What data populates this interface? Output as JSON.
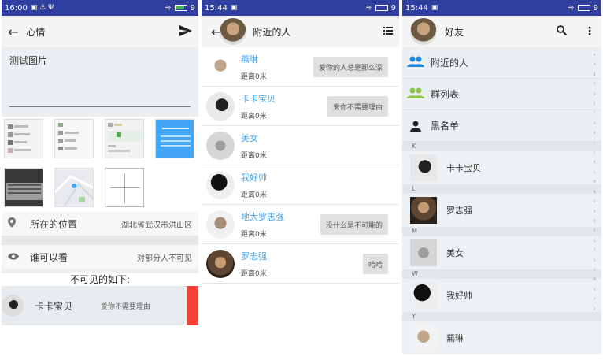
{
  "panel1": {
    "status": {
      "time": "16:00",
      "battery": "9"
    },
    "title": "心情",
    "mood_text": "测试图片",
    "location_label": "所在的位置",
    "location_value": "湖北省武汉市洪山区",
    "visibility_label": "谁可以看",
    "visibility_value": "对部分人不可见",
    "invisible_title": "不可见的如下:",
    "friend": {
      "name": "卡卡宝贝",
      "signature": "爱你不需要理由"
    }
  },
  "panel2": {
    "status": {
      "time": "15:44",
      "battery": "9"
    },
    "title": "附近的人",
    "people": [
      {
        "name": "燕琳",
        "distance": "距离0米",
        "message": "爱你的人总是那么深"
      },
      {
        "name": "卡卡宝贝",
        "distance": "距离0米",
        "message": "爱你不需要理由"
      },
      {
        "name": "美女",
        "distance": "距离0米",
        "message": ""
      },
      {
        "name": "我好帅",
        "distance": "距离0米",
        "message": ""
      },
      {
        "name": "地大罗志强",
        "distance": "距离0米",
        "message": "没什么是不可能的"
      },
      {
        "name": "罗志强",
        "distance": "距离0米",
        "message": "哈哈"
      }
    ]
  },
  "panel3": {
    "status": {
      "time": "15:44",
      "battery": "9"
    },
    "title": "好友",
    "menu": [
      "附近的人",
      "群列表",
      "黑名单"
    ],
    "groups": [
      {
        "letter": "K",
        "name": "卡卡宝贝"
      },
      {
        "letter": "L",
        "name": "罗志强"
      },
      {
        "letter": "M",
        "name": "美女"
      },
      {
        "letter": "W",
        "name": "我好帅"
      },
      {
        "letter": "Y",
        "name": "燕琳"
      }
    ],
    "index_letters": "# A B C D E F G H I J K L M N O P Q R S T U V W X Y Z"
  },
  "colors": {
    "status_bar": "#303f9f",
    "accent_blue": "#42a5f5",
    "red": "#f44336"
  }
}
